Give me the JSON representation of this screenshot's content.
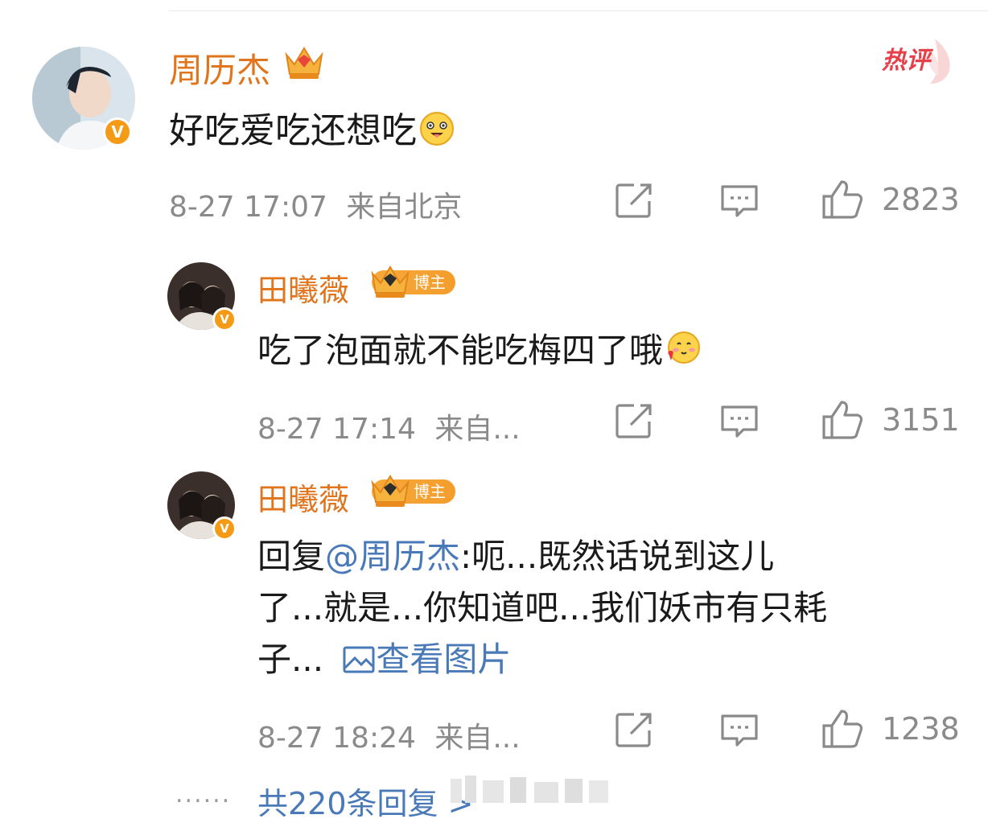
{
  "hot_label": "热评",
  "main_comment": {
    "author": "周历杰",
    "text": "好吃爱吃还想吃",
    "time": "8-27 17:07",
    "location": "来自北京",
    "likes": "2823"
  },
  "replies": [
    {
      "author": "田曦薇",
      "badge": "博主",
      "text": "吃了泡面就不能吃梅四了哦",
      "time": "8-27 17:14",
      "location": "来自...",
      "likes": "3151"
    },
    {
      "author": "田曦薇",
      "badge": "博主",
      "reply_prefix": "回复",
      "mention": "@周历杰",
      "text_line1": ":呃...既然话说到这儿",
      "text_line2": "了...就是...你知道吧...我们妖市有只耗",
      "text_line3": "子...",
      "view_image": "查看图片",
      "time": "8-27 18:24",
      "location": "来自...",
      "likes": "1238"
    }
  ],
  "more_dots": "......",
  "more_replies": "共220条回复 >",
  "icons": [
    "share-icon",
    "comment-icon",
    "like-icon",
    "verified-v-icon",
    "crown-icon",
    "image-icon"
  ],
  "colors": {
    "name": "#e0751d",
    "link": "#4a79b8",
    "meta": "#8a8a8a",
    "hot": "#e6414a",
    "badge": "#f59a15"
  }
}
